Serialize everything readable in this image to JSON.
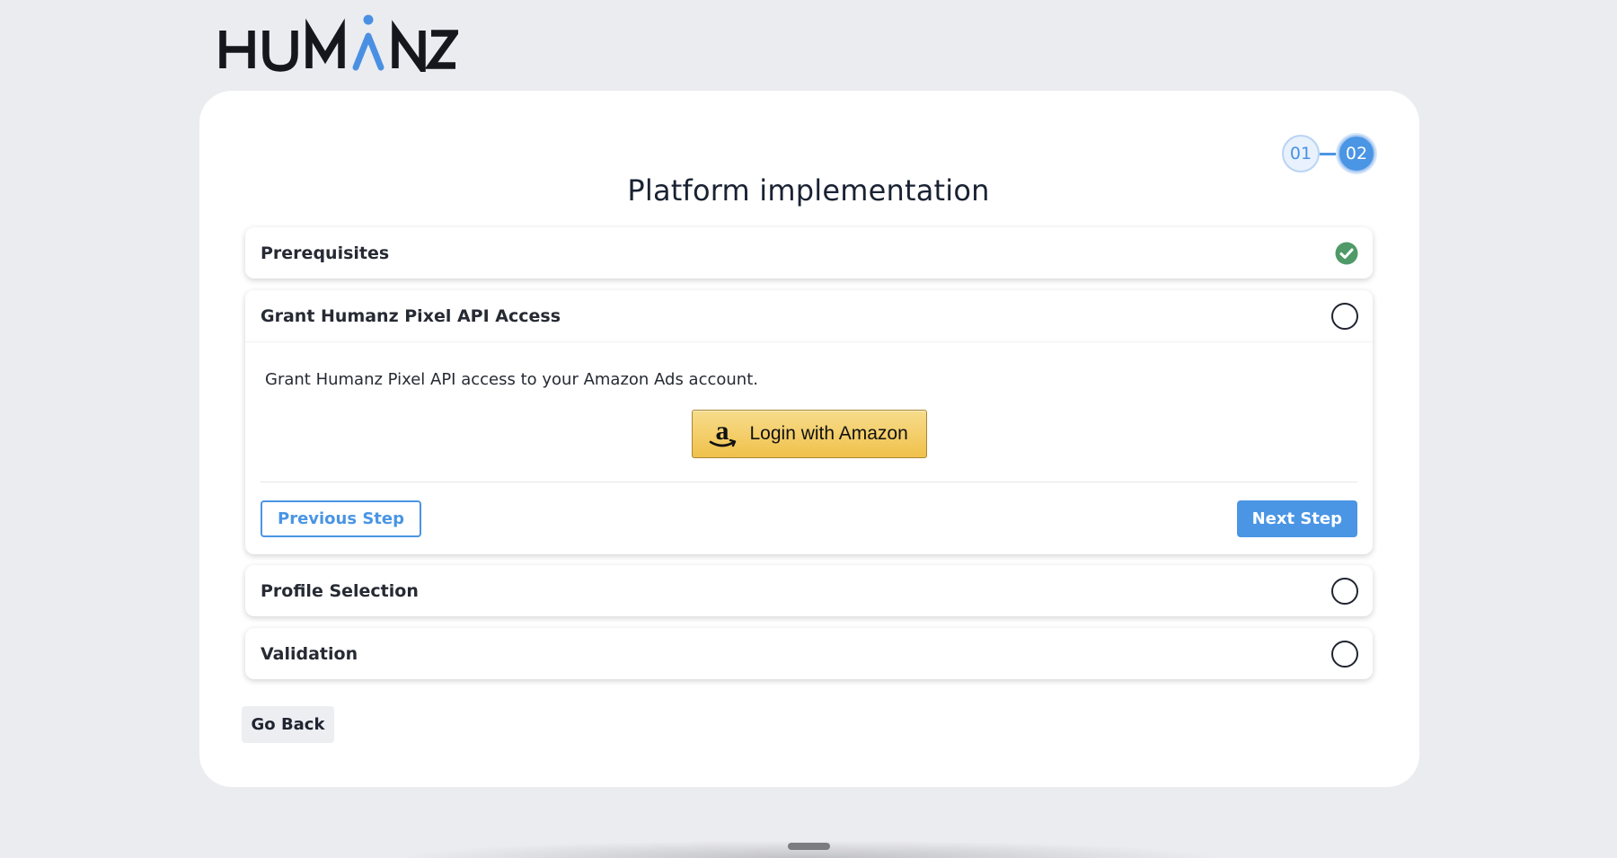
{
  "brand": {
    "logo_text": "HUMANZ",
    "accent_color": "#4a95e4",
    "success_color": "#4f9a68"
  },
  "stepper": {
    "steps": [
      "01",
      "02"
    ],
    "active_step": "02"
  },
  "page_title": "Platform implementation",
  "sections": [
    {
      "title": "Prerequisites",
      "status": "complete",
      "status_icon": "check-circle-icon"
    },
    {
      "title": "Grant Humanz Pixel API Access",
      "status": "incomplete",
      "status_icon": "empty-circle-icon",
      "expanded": true,
      "description": "Grant Humanz Pixel API access to your Amazon Ads account.",
      "amazon_button_label": "Login with Amazon",
      "previous_label": "Previous Step",
      "next_label": "Next Step"
    },
    {
      "title": "Profile Selection",
      "status": "incomplete",
      "status_icon": "empty-circle-icon"
    },
    {
      "title": "Validation",
      "status": "incomplete",
      "status_icon": "empty-circle-icon"
    }
  ],
  "go_back_label": "Go Back"
}
